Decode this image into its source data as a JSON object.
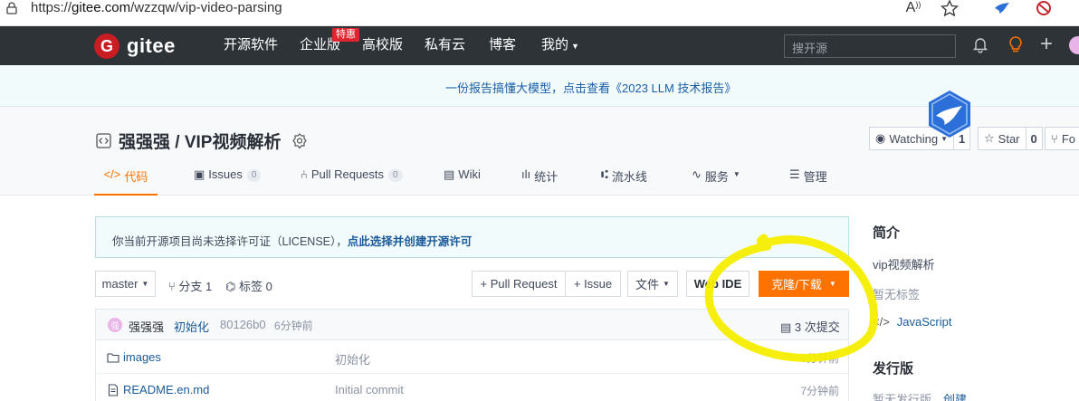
{
  "browser": {
    "url_prefix": "https://",
    "url_domain": "gitee.com",
    "url_path": "/wzzqw/vip-video-parsing",
    "read_aloud_label": "A",
    "toolbar_icons": [
      "lock-icon",
      "read-aloud-icon",
      "favorite-star-icon",
      "extension-bird-icon",
      "adblock-icon"
    ]
  },
  "topnav": {
    "logo_letter": "G",
    "logo_text": "gitee",
    "items": [
      {
        "label": "开源软件"
      },
      {
        "label": "企业版"
      },
      {
        "label": "高校版"
      },
      {
        "label": "私有云"
      },
      {
        "label": "博客"
      },
      {
        "label": "我的"
      }
    ],
    "hot_badge": "特惠",
    "search_placeholder": "搜开源",
    "plus_glyph": "+"
  },
  "banner": {
    "text": "一份报告搞懂大模型，点击查看《2023 LLM 技术报告》"
  },
  "project": {
    "title": "强强强 / VIP视频解析",
    "watch_label": "Watching",
    "watch_count": "1",
    "star_label": "Star",
    "star_count": "0",
    "fork_label": "Fo",
    "tabs": [
      {
        "label": "代码",
        "icon": "</>"
      },
      {
        "label": "Issues",
        "count": "0"
      },
      {
        "label": "Pull Requests",
        "count": "0"
      },
      {
        "label": "Wiki"
      },
      {
        "label": "统计"
      },
      {
        "label": "流水线"
      },
      {
        "label": "服务"
      },
      {
        "label": "管理"
      }
    ]
  },
  "notice": {
    "text": "你当前开源项目尚未选择许可证（LICENSE），",
    "link": "点此选择并创建开源许可"
  },
  "toolbar": {
    "branch": "master",
    "branches": "分支 1",
    "tags": "标签 0",
    "pull_request": "+ Pull Request",
    "issue": "+ Issue",
    "file_menu": "文件",
    "web_ide": "Web IDE",
    "clone": "克隆/下载"
  },
  "commit": {
    "avatar_letter": "强",
    "author": "强强强",
    "message": "初始化",
    "hash": "80126b0",
    "time": "6分钟前",
    "count": "3 次提交"
  },
  "files": [
    {
      "name": "images",
      "type": "folder",
      "message": "初始化",
      "time": "6分钟前"
    },
    {
      "name": "README.en.md",
      "type": "file",
      "message": "Initial commit",
      "time": "7分钟前"
    }
  ],
  "sidebar": {
    "intro_title": "简介",
    "description": "vip视频解析",
    "no_tags": "暂无标签",
    "language": "JavaScript",
    "release_title": "发行版",
    "no_release": "暂无发行版，",
    "create_link": "创建"
  },
  "colors": {
    "nav_bg": "#2e3338",
    "accent": "#fe7300",
    "logo_red": "#c71d23",
    "highlight_marker": "#f5ee00"
  }
}
